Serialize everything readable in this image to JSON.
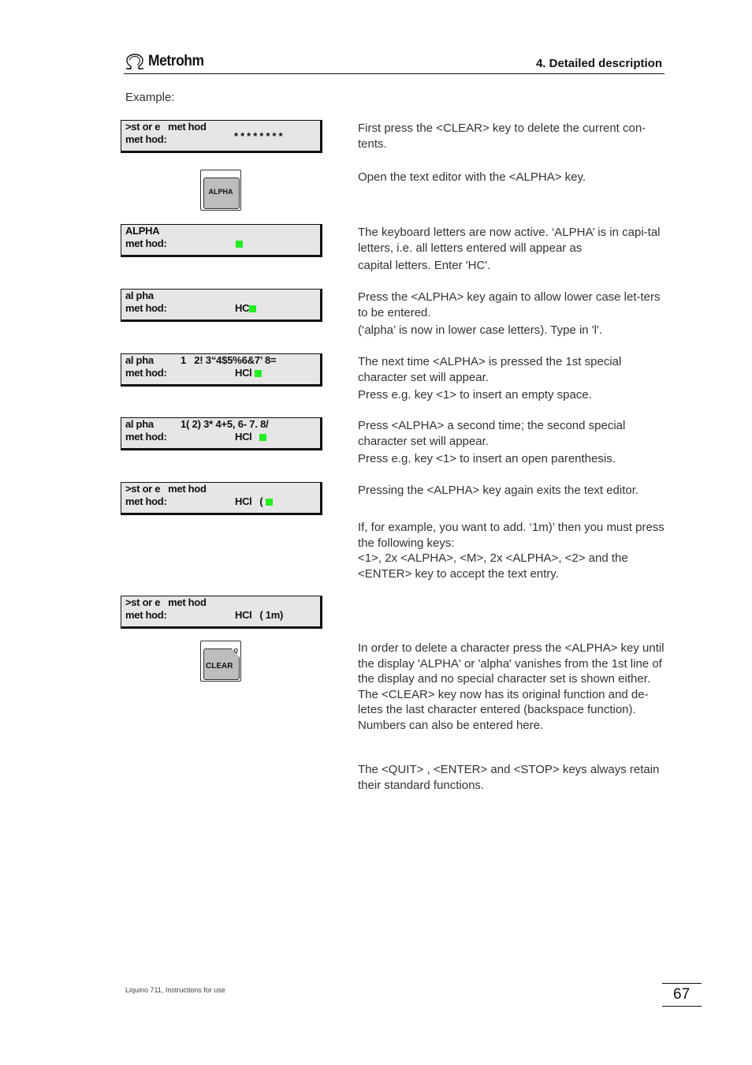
{
  "header": {
    "brand": "Metrohm",
    "logo_icon": "omega-icon",
    "chapter": "4. Detailed description"
  },
  "intro": "Example:",
  "colors": {
    "cursor": "#22ee22",
    "lcd_bg": "#e6e6e6",
    "key_face": "#bdbdbd"
  },
  "displays": [
    {
      "line1": ">st or e   met hod",
      "set": "",
      "line2": "met hod:",
      "value": "* * * * * * * *",
      "cursor": false
    },
    {
      "line1": "ALPHA",
      "set": "",
      "line2": "met hod:",
      "value": "",
      "cursor": true
    },
    {
      "line1": "al pha",
      "set": "",
      "line2": "met hod:",
      "value": "HC",
      "cursor": true
    },
    {
      "line1": "al pha",
      "set": "1   2! 3“4$5%6&7’ 8=",
      "line2": "met hod:",
      "value": "HCl ",
      "cursor": true
    },
    {
      "line1": "al pha",
      "set": "1( 2) 3* 4+5, 6- 7. 8/",
      "line2": "met hod:",
      "value": "HCl   ",
      "cursor": true
    },
    {
      "line1": ">st or e   met hod",
      "set": "",
      "line2": "met hod:",
      "value": "HCl   ( ",
      "cursor": true
    },
    {
      "line1": ">st or e   met hod",
      "set": "",
      "line2": "met hod:",
      "value": "HCl   ( 1m)",
      "cursor": false
    }
  ],
  "keys": {
    "alpha": {
      "label": "ALPHA"
    },
    "clear": {
      "label": "CLEAR",
      "secondary": "Q"
    }
  },
  "paragraphs": [
    [
      "First press the <CLEAR> key to delete the current con-tents."
    ],
    [
      "Open the text editor with the <ALPHA> key."
    ],
    [
      "The keyboard letters are now active. ‘ALPHA’ is in capi-tal letters, i.e. all letters entered will appear as",
      "capital letters. Enter 'HC'."
    ],
    [
      "Press the <ALPHA> key again to allow lower case let-ters to be entered.",
      "(‘alpha’ is now in lower case letters). Type in 'l'."
    ],
    [
      "The next time <ALPHA> is pressed the 1st special character set will appear.",
      "Press e.g. key <1> to insert an empty space."
    ],
    [
      "Press <ALPHA> a second time; the second special character set will appear.",
      "Press e.g. key <1> to insert an open parenthesis."
    ],
    [
      "Pressing the <ALPHA> key again exits the text editor."
    ],
    [
      "If, for example, you want to add. ‘1m)’ then you must press the following keys:",
      "<1>, 2x <ALPHA>, <M>, 2x <ALPHA>, <2> and the <ENTER> key to accept the text entry."
    ],
    [
      "In order to delete a character press the <ALPHA> key until the display 'ALPHA' or 'alpha' vanishes from the 1st line of the display and no special character set is shown either.",
      "The <CLEAR> key now has its original function and de-letes the last character entered (backspace function). Numbers can also be entered here."
    ],
    [
      "The <QUIT> , <ENTER> and <STOP> keys always retain their standard functions."
    ]
  ],
  "footer": {
    "doc_title": "Liquino 711, Instructions for use",
    "page_number": "67"
  }
}
